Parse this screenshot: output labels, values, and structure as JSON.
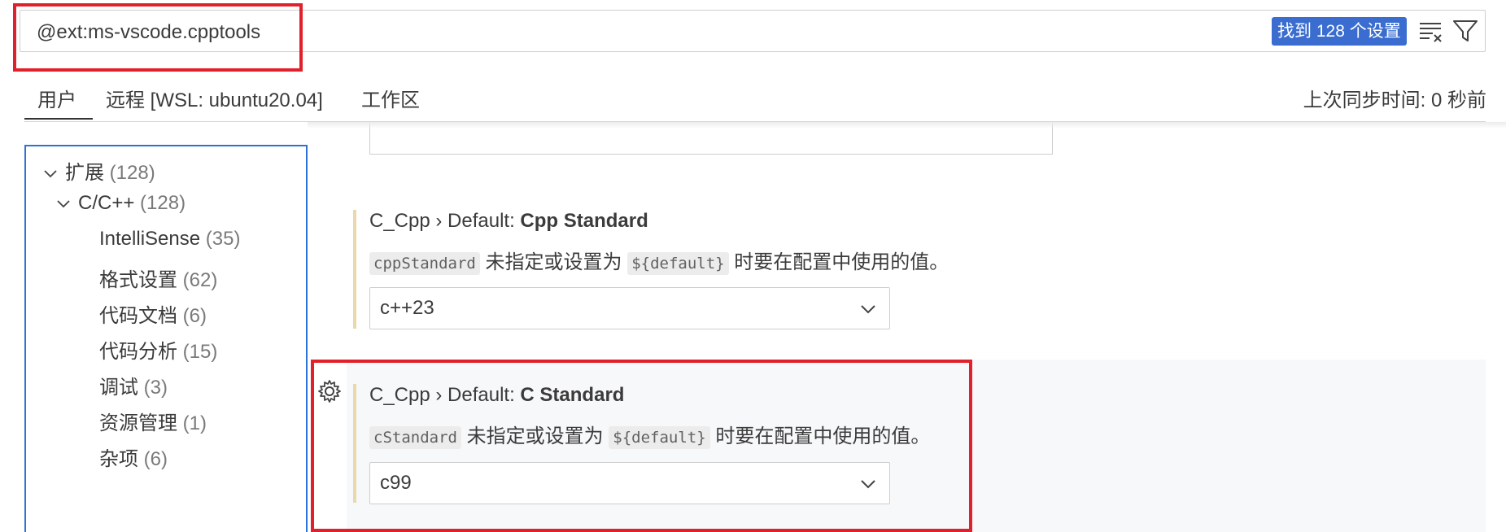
{
  "search": {
    "value": "@ext:ms-vscode.cpptools",
    "result_badge": "找到 128 个设置"
  },
  "icons": {
    "clear": "clear-filter-icon",
    "filter": "filter-icon",
    "gear": "gear-icon",
    "chevron": "chevron-down-icon"
  },
  "tabs": {
    "user": "用户",
    "remote": "远程 [WSL: ubuntu20.04]",
    "workspace": "工作区"
  },
  "sync_status": "上次同步时间: 0 秒前",
  "toc": [
    {
      "label": "扩展",
      "count": "(128)"
    },
    {
      "label": "C/C++",
      "count": "(128)"
    },
    {
      "label": "IntelliSense",
      "count": "(35)"
    },
    {
      "label": "格式设置",
      "count": "(62)"
    },
    {
      "label": "代码文档",
      "count": "(6)"
    },
    {
      "label": "代码分析",
      "count": "(15)"
    },
    {
      "label": "调试",
      "count": "(3)"
    },
    {
      "label": "资源管理",
      "count": "(1)"
    },
    {
      "label": "杂项",
      "count": "(6)"
    }
  ],
  "settings": [
    {
      "category": "C_Cpp › Default: ",
      "name": "Cpp Standard",
      "code_key": "cppStandard",
      "desc_mid": " 未指定或设置为 ",
      "code_default": "${default}",
      "desc_end": " 时要在配置中使用的值。",
      "value": "c++23"
    },
    {
      "category": "C_Cpp › Default: ",
      "name": "C Standard",
      "code_key": "cStandard",
      "desc_mid": " 未指定或设置为 ",
      "code_default": "${default}",
      "desc_end": " 时要在配置中使用的值。",
      "value": "c99"
    }
  ],
  "colors": {
    "highlight": "#e0212b",
    "badge": "#3a6dcf",
    "toc_border": "#2f72d6",
    "modified_bar": "#e9d9ac"
  }
}
